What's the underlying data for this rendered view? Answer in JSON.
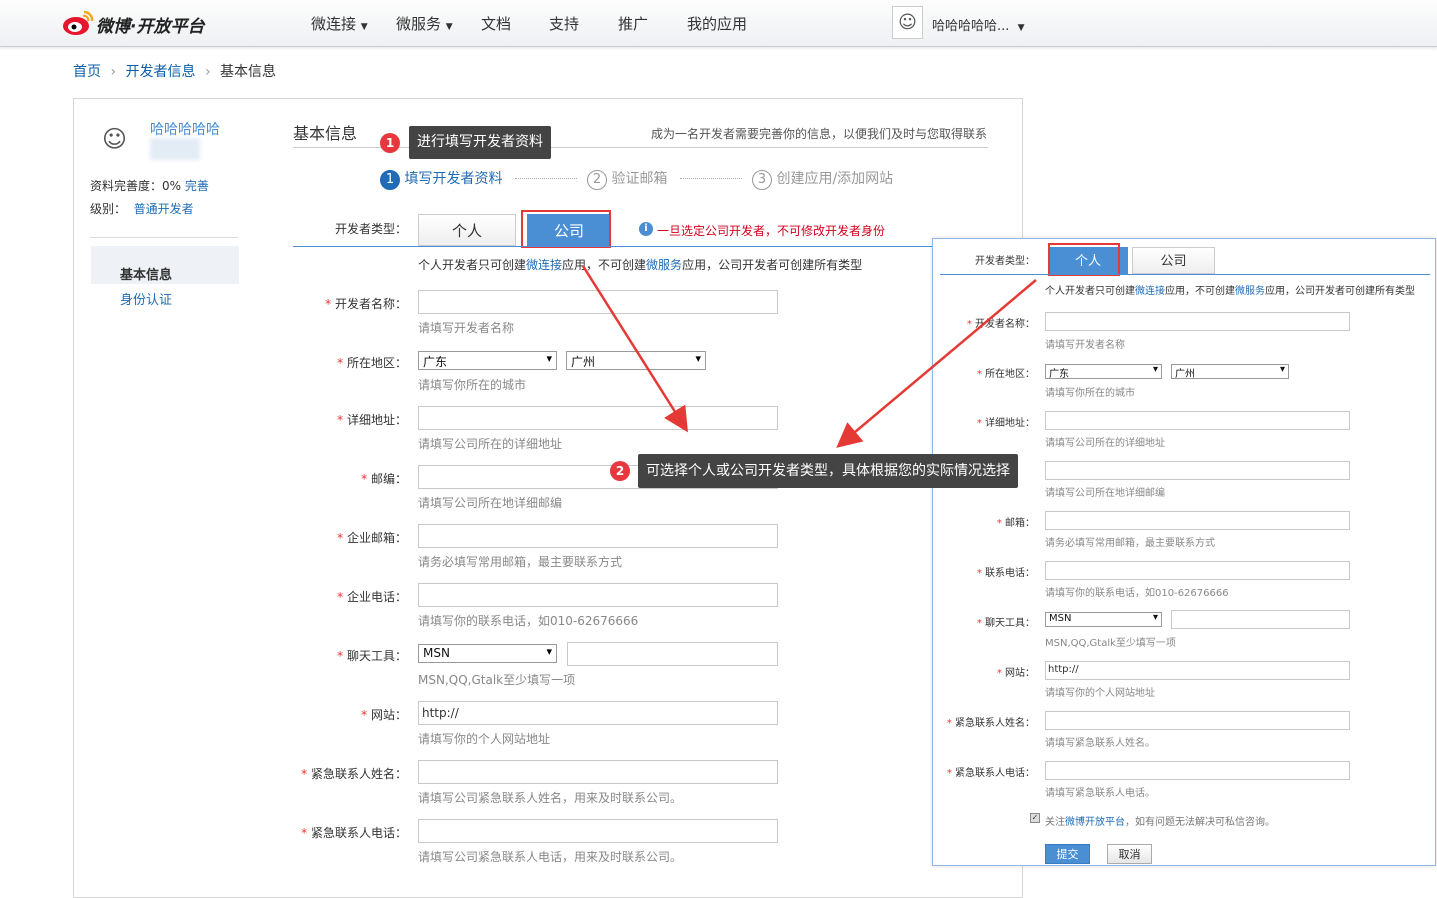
{
  "header": {
    "logo": "微博·开放平台",
    "nav": [
      "微连接",
      "微服务",
      "文档",
      "支持",
      "推广",
      "我的应用"
    ],
    "user": "哈哈哈哈哈..."
  },
  "breadcrumb": [
    "首页",
    "开发者信息",
    "基本信息"
  ],
  "sidebar": {
    "username": "哈哈哈哈哈",
    "completeness_label": "资料完善度：0%",
    "complete_link": "完善",
    "level_label": "级别：",
    "level_value": "普通开发者",
    "menu": [
      "基本信息",
      "身份认证"
    ]
  },
  "main": {
    "title": "基本信息",
    "subtitle": "成为一名开发者需要完善你的信息，以便我们及时与您取得联系",
    "steps": [
      {
        "n": "1",
        "label": "填写开发者资料"
      },
      {
        "n": "2",
        "label": "验证邮箱"
      },
      {
        "n": "3",
        "label": "创建应用/添加网站"
      }
    ],
    "type_label": "开发者类型：",
    "tabs": [
      "个人",
      "公司"
    ],
    "company_warning": "一旦选定公司开发者，不可修改开发者身份",
    "type_note_parts": [
      "个人开发者只可创建",
      "微连接",
      "应用，不可创建",
      "微服务",
      "应用，公司开发者可创建所有类型"
    ],
    "fields": {
      "name": {
        "label": "开发者名称：",
        "hint": "请填写开发者名称"
      },
      "region": {
        "label": "所在地区：",
        "province": "广东",
        "city": "广州",
        "hint": "请填写你所在的城市"
      },
      "address": {
        "label": "详细地址：",
        "hint": "请填写公司所在的详细地址"
      },
      "zip": {
        "label": "邮编：",
        "hint": "请填写公司所在地详细邮编"
      },
      "email": {
        "label": "企业邮箱：",
        "hint": "请务必填写常用邮箱，最主要联系方式"
      },
      "phone": {
        "label": "企业电话：",
        "hint": "请填写你的联系电话，如010-62676666"
      },
      "chat": {
        "label": "聊天工具：",
        "value": "MSN",
        "hint": "MSN,QQ,Gtalk至少填写一项"
      },
      "website": {
        "label": "网站：",
        "value": "http://",
        "hint": "请填写你的个人网站地址"
      },
      "contact_name": {
        "label": "紧急联系人姓名：",
        "hint": "请填写公司紧急联系人姓名，用来及时联系公司。"
      },
      "contact_phone": {
        "label": "紧急联系人电话：",
        "hint": "请填写公司紧急联系人电话，用来及时联系公司。"
      }
    }
  },
  "tips": {
    "t1": {
      "n": "1",
      "text": "进行填写开发者资料"
    },
    "t2": {
      "n": "2",
      "text": "可选择个人或公司开发者类型，具体根据您的实际情况选择"
    }
  },
  "panel": {
    "type_label": "开发者类型：",
    "tabs": [
      "个人",
      "公司"
    ],
    "note_parts": [
      "个人开发者只可创建",
      "微连接",
      "应用，不可创建",
      "微服务",
      "应用，公司开发者可创建所有类型"
    ],
    "fields": [
      {
        "label": "开发者名称：",
        "hint": "请填写开发者名称"
      },
      {
        "label": "所在地区：",
        "hint": "请填写你所在的城市"
      },
      {
        "label": "详细地址：",
        "hint": "请填写公司所在的详细地址"
      },
      {
        "label": "",
        "hint": "请填写公司所在地详细邮编"
      },
      {
        "label": "邮箱：",
        "hint": "请务必填写常用邮箱，最主要联系方式"
      },
      {
        "label": "联系电话：",
        "hint": "请填写你的联系电话，如010-62676666"
      },
      {
        "label": "聊天工具：",
        "hint": "MSN,QQ,Gtalk至少填写一项"
      },
      {
        "label": "网站：",
        "hint": "请填写你的个人网站地址"
      },
      {
        "label": "紧急联系人姓名：",
        "hint": "请填写紧急联系人姓名。"
      },
      {
        "label": "紧急联系人电话：",
        "hint": "请填写紧急联系人电话。"
      }
    ],
    "province": "广东",
    "city": "广州",
    "chat": "MSN",
    "website": "http://",
    "follow_parts": [
      "关注",
      "微博开放平台",
      "，如有问题无法解决可私信咨询。"
    ],
    "submit": "提交",
    "cancel": "取消"
  },
  "colors": {
    "accent": "#4a8fd3",
    "link": "#1f6bb5",
    "warning": "#d0021b",
    "highlight": "#e53935"
  }
}
